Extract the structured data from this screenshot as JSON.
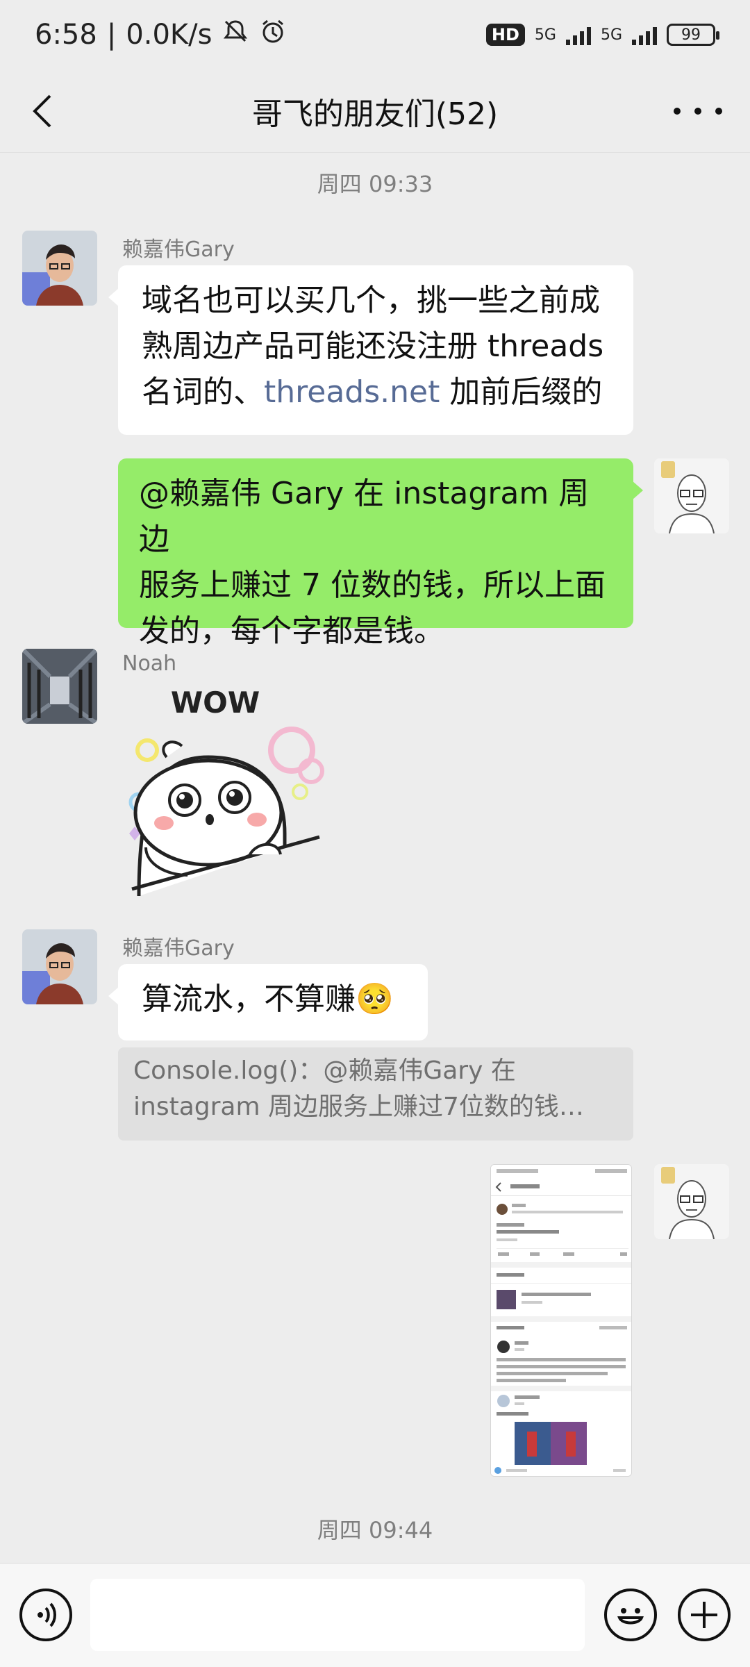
{
  "status_bar": {
    "time": "6:58",
    "network_speed": "0.0K/s",
    "hd_badge": "HD",
    "signal1_label": "5G",
    "signal2_label": "5G",
    "battery": "99"
  },
  "header": {
    "title": "哥飞的朋友们(52)"
  },
  "timestamps": [
    "周四 09:33",
    "周四 09:44"
  ],
  "messages": {
    "gary1": {
      "sender": "赖嘉伟Gary",
      "line1": "域名也可以买几个，挑一些之前成",
      "line2": "熟周边产品可能还没注册 threads",
      "line3_pre": "名词的、",
      "line3_link": "threads.net",
      "line3_post": " 加前后缀的"
    },
    "self1": {
      "line1": "@赖嘉伟 Gary  在 instagram 周边",
      "line2": "服务上赚过 7 位数的钱，所以上面",
      "line3": "发的，每个字都是钱。"
    },
    "noah": {
      "sender": "Noah",
      "sticker_text": "WOW"
    },
    "gary2": {
      "sender": "赖嘉伟Gary",
      "text": "算流水，不算赚🥺",
      "quote_line1": "Console.log()：@赖嘉伟Gary 在",
      "quote_line2": "instagram 周边服务上赚过7位数的钱…"
    }
  },
  "input_bar": {
    "voice_icon": "voice-icon",
    "emoji_icon": "emoji-icon",
    "plus_icon": "plus-icon"
  },
  "colors": {
    "background": "#ededed",
    "green_bubble": "#95ec69",
    "link": "#576b95"
  }
}
